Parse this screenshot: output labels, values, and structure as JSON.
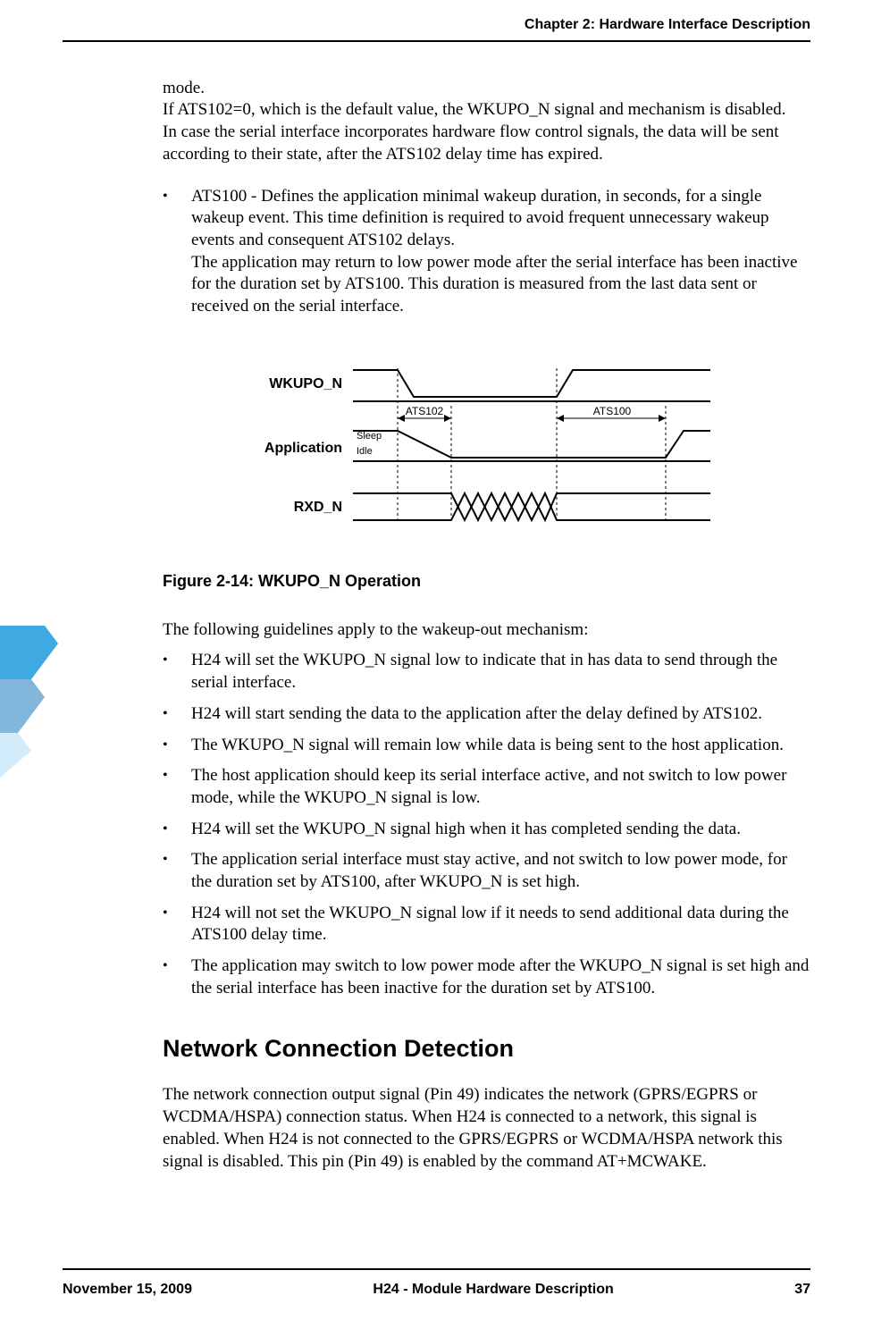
{
  "header": {
    "chapter_label": "Chapter 2:  Hardware Interface Description"
  },
  "content": {
    "mode_continue_1": "mode.",
    "mode_continue_2": "If ATS102=0, which is the default value, the WKUPO_N signal and mechanism is disabled.",
    "mode_continue_3": "In case the serial interface incorporates hardware flow control signals, the data will be sent according to their state, after the ATS102 delay time has expired.",
    "bullet_ats100_a": "ATS100 - Defines the application minimal wakeup duration, in seconds, for a single wakeup event. This time definition is required to avoid frequent unnecessary wakeup events and consequent ATS102 delays.",
    "bullet_ats100_b": "The application may return to low power mode after the serial interface has been inactive for the duration set by ATS100. This duration is measured from the last data sent or received on the serial interface.",
    "figure_caption": "Figure 2-14: WKUPO_N Operation",
    "guidelines_intro": "The following guidelines apply to the wakeup-out mechanism:",
    "g1": "H24 will set the WKUPO_N signal low to indicate that in has data to send through the serial interface.",
    "g2": "H24 will start sending the data to the application after the delay defined by ATS102.",
    "g3": "The WKUPO_N signal will remain low while data is being sent to the host application.",
    "g4": "The host application should keep its serial interface active, and not switch to low power mode, while the WKUPO_N signal is low.",
    "g5": "H24 will set the WKUPO_N signal high when it has completed sending the data.",
    "g6": "The application serial interface must stay active, and not switch to low power mode, for the duration set by ATS100, after WKUPO_N is set high.",
    "g7": "H24 will not set the WKUPO_N signal low if it needs to send additional data during the ATS100 delay time.",
    "g8": "The application may switch to low power mode after the WKUPO_N signal is set high and the serial interface has been inactive for the duration set by ATS100.",
    "h2_network": "Network Connection Detection",
    "network_para": "The network connection output signal (Pin 49) indicates the network (GPRS/EGPRS or WCDMA/HSPA) connection status. When H24 is connected to a network, this signal is enabled. When H24 is not connected to the GPRS/EGPRS or WCDMA/HSPA network this signal is disabled. This pin (Pin 49) is enabled by the command AT+MCWAKE."
  },
  "diagram": {
    "label_wkupo": "WKUPO_N",
    "label_application": "Application",
    "label_rxd": "RXD_N",
    "label_ats102": "ATS102",
    "label_ats100": "ATS100",
    "label_sleep": "Sleep",
    "label_idle": "Idle"
  },
  "footer": {
    "date": "November 15, 2009",
    "title": "H24 - Module Hardware Description",
    "page": "37"
  }
}
